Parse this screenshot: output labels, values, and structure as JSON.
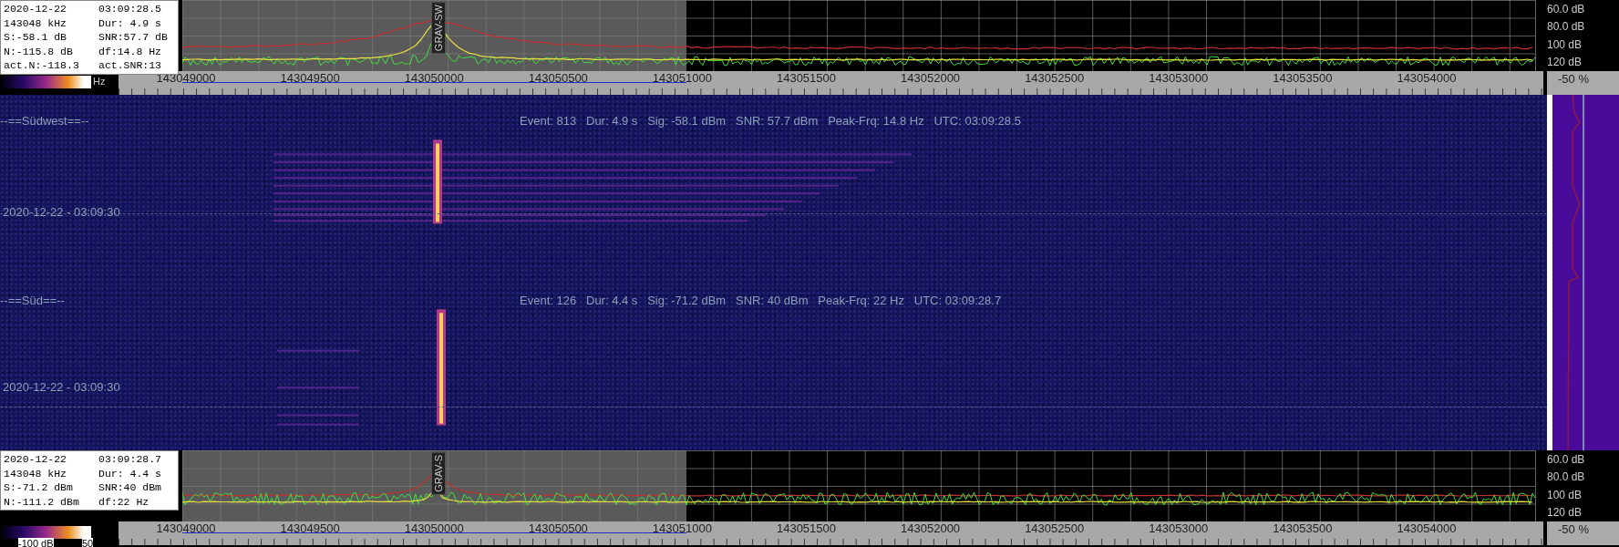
{
  "top_panel": {
    "info": [
      {
        "left": "2020-12-22",
        "right": "03:09:28.5"
      },
      {
        "left": "143048 kHz",
        "right": "Dur: 4.9 s"
      },
      {
        "left": "S:-58.1 dB",
        "right": "SNR:57.7 dB"
      },
      {
        "left": "N:-115.8 dB",
        "right": "df:14.8 Hz"
      },
      {
        "left": "act.N:-118.3",
        "right": "act.SNR:13"
      }
    ],
    "marker_tag": "GRAV-SW",
    "db_labels": [
      "60.0 dB",
      "80.0 dB",
      "100 dB",
      "120 dB"
    ],
    "colorbar_labels": [
      "Hz"
    ],
    "freq_labels": [
      "143049000",
      "143049500",
      "143050000",
      "143050500",
      "143051000",
      "143051500",
      "143052000",
      "143052500",
      "143053000",
      "143053500",
      "143054000"
    ],
    "percent": "-50 %"
  },
  "waterfall": {
    "sections": [
      {
        "title": "--==Südwest==--",
        "event": "Event: 813   Dur: 4.9 s   Sig: -58.1 dBm   SNR: 57.7 dBm   Peak-Frq: 14.8 Hz   UTC: 03:09:28.5",
        "timestamp": "2020-12-22 - 03:09:30"
      },
      {
        "title": "--==Süd==--",
        "event": "Event: 126   Dur: 4.4 s   Sig: -71.2 dBm   SNR: 40 dBm   Peak-Frq: 22 Hz   UTC: 03:09:28.7",
        "timestamp": "2020-12-22 - 03:09:30"
      }
    ]
  },
  "bottom_panel": {
    "info": [
      {
        "left": "2020-12-22",
        "right": "03:09:28.7"
      },
      {
        "left": "143048 kHz",
        "right": "Dur: 4.4 s"
      },
      {
        "left": "S:-71.2 dBm",
        "right": "SNR:40 dBm"
      },
      {
        "left": "N:-111.2 dBm",
        "right": "df:22 Hz"
      }
    ],
    "marker_tag": "GRAV-S",
    "db_labels": [
      "60.0 dB",
      "80.0 dB",
      "100 dB",
      "120 dB"
    ],
    "colorbar_labels": [
      "-100 dB",
      "50"
    ],
    "freq_labels": [
      "143049000",
      "143049500",
      "143050000",
      "143050500",
      "143051000",
      "143051500",
      "143052000",
      "143052500",
      "143053000",
      "143053500",
      "143054000"
    ],
    "percent": "-50 %"
  }
}
